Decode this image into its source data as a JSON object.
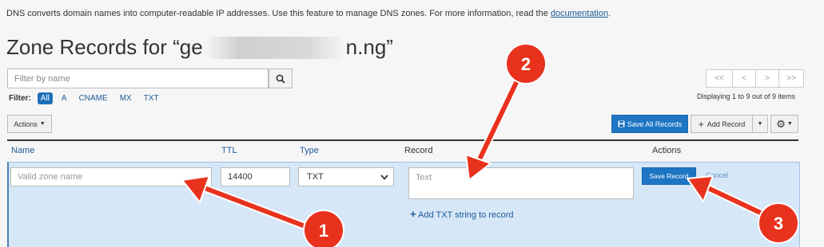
{
  "intro": {
    "text": "DNS converts domain names into computer-readable IP addresses. Use this feature to manage DNS zones. For more information, read the ",
    "link": "documentation",
    "end": "."
  },
  "heading": {
    "prefix": "Zone Records for “ge",
    "suffix": "n.ng”"
  },
  "filter": {
    "placeholder": "Filter by name",
    "label": "Filter:",
    "pills": [
      "All",
      "A",
      "CNAME",
      "MX",
      "TXT"
    ]
  },
  "pagination": {
    "first": "<<",
    "prev": "<",
    "next": ">",
    "last": ">>",
    "displaying": "Displaying 1 to 9 out of 9 items"
  },
  "toolbar": {
    "actions": "Actions",
    "save_all": "Save All Records",
    "add_record": "Add Record"
  },
  "table": {
    "headers": {
      "name": "Name",
      "ttl": "TTL",
      "type": "Type",
      "record": "Record",
      "actions": "Actions"
    }
  },
  "edit_row": {
    "name_placeholder": "Valid zone name",
    "ttl_value": "14400",
    "type_value": "TXT",
    "record_placeholder": "Text",
    "add_txt": "Add TXT string to record",
    "save": "Save Record",
    "cancel": "Cancel"
  },
  "annotations": [
    {
      "label": "1"
    },
    {
      "label": "2"
    },
    {
      "label": "3"
    }
  ],
  "colors": {
    "accent": "#1d75c3",
    "edit_row_bg": "#d6e7f7",
    "annotation": "#e8321e"
  }
}
